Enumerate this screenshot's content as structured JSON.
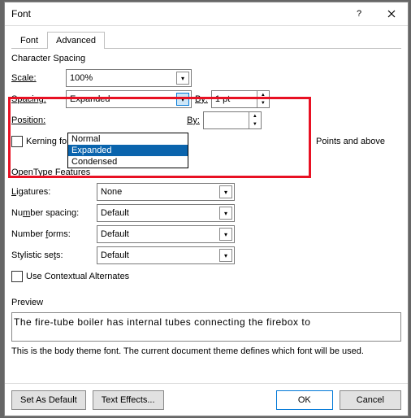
{
  "title": "Font",
  "tabs": {
    "font": "Font",
    "advanced": "Advanced"
  },
  "charSpacing": {
    "title": "Character Spacing",
    "scaleLbl": "Scale:",
    "scaleVal": "100%",
    "spacingLbl": "Spacing:",
    "spacingVal": "Expanded",
    "spacingOpts": {
      "normal": "Normal",
      "expanded": "Expanded",
      "condensed": "Condensed"
    },
    "byLbl": "By:",
    "byVal": "1 pt",
    "positionLbl": "Position:",
    "kerningLbl": "Kerning for fonts:",
    "pointsLbl": "Points and above"
  },
  "ot": {
    "title": "OpenType Features",
    "ligaturesLbl": "Ligatures:",
    "ligaturesVal": "None",
    "numSpacingLbl": "Number spacing:",
    "numSpacingVal": "Default",
    "numFormsLbl": "Number forms:",
    "numFormsVal": "Default",
    "styLbl": "Stylistic sets:",
    "styVal": "Default",
    "contextualLbl": "Use Contextual Alternates"
  },
  "preview": {
    "title": "Preview",
    "text": "The fire-tube boiler has internal tubes connecting the firebox to",
    "note": "This is the body theme font. The current document theme defines which font will be used."
  },
  "buttons": {
    "setDefault": "Set As Default",
    "textEffects": "Text Effects...",
    "ok": "OK",
    "cancel": "Cancel"
  }
}
